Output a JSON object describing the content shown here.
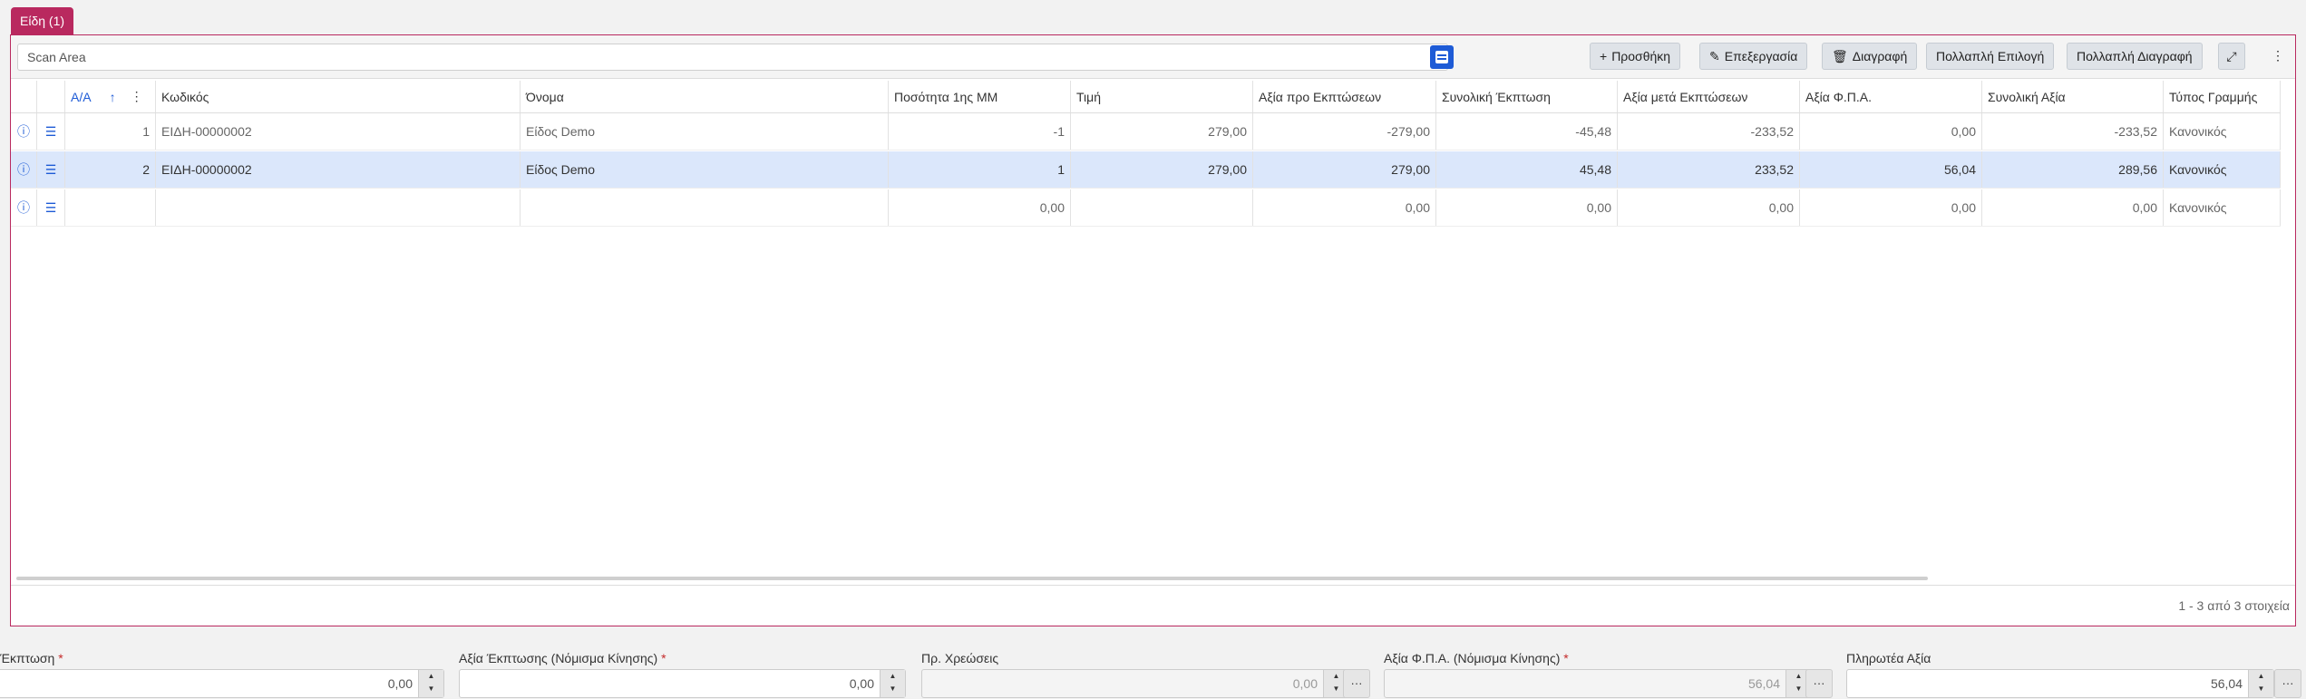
{
  "tab": {
    "label": "Είδη (1)"
  },
  "toolbar": {
    "scan_placeholder": "Scan Area",
    "add_label": "Προσθήκη",
    "edit_label": "Επεξεργασία",
    "delete_label": "Διαγραφή",
    "multi_select_label": "Πολλαπλή Επιλογή",
    "multi_delete_label": "Πολλαπλή Διαγραφή"
  },
  "columns": {
    "aa": "Α/Α",
    "code": "Κωδικός",
    "name": "Όνομα",
    "qty": "Ποσότητα 1ης ΜΜ",
    "price": "Τιμή",
    "value_before": "Αξία προ Εκπτώσεων",
    "total_discount": "Συνολική Έκπτωση",
    "value_after": "Αξία μετά Εκπτώσεων",
    "vat": "Αξία Φ.Π.Α.",
    "total": "Συνολική Αξία",
    "line_type": "Τύπος Γραμμής"
  },
  "rows": [
    {
      "aa": "1",
      "code": "ΕΙΔΗ-00000002",
      "name": "Είδος Demo",
      "qty": "-1",
      "price": "279,00",
      "value_before": "-279,00",
      "total_discount": "-45,48",
      "value_after": "-233,52",
      "vat": "0,00",
      "total": "-233,52",
      "line_type": "Κανονικός"
    },
    {
      "aa": "2",
      "code": "ΕΙΔΗ-00000002",
      "name": "Είδος Demo",
      "qty": "1",
      "price": "279,00",
      "value_before": "279,00",
      "total_discount": "45,48",
      "value_after": "233,52",
      "vat": "56,04",
      "total": "289,56",
      "line_type": "Κανονικός"
    },
    {
      "aa": "",
      "code": "",
      "name": "",
      "qty": "0,00",
      "price": "",
      "value_before": "0,00",
      "total_discount": "0,00",
      "value_after": "0,00",
      "vat": "0,00",
      "total": "0,00",
      "line_type": "Κανονικός"
    }
  ],
  "pager": "1 - 3 από 3 στοιχεία",
  "fields": {
    "discount": {
      "label": "Έκπτωση",
      "value": "0,00"
    },
    "discount_value_currency": {
      "label": "Αξία Έκπτωσης (Νόμισμα Κίνησης)",
      "value": "0,00"
    },
    "extra_charges": {
      "label": "Πρ. Χρεώσεις",
      "value": "0,00"
    },
    "vat_value_currency": {
      "label": "Αξία Φ.Π.Α. (Νόμισμα Κίνησης)",
      "value": "56,04"
    },
    "payable": {
      "label": "Πληρωτέα Αξία",
      "value": "56,04"
    }
  },
  "required_mark": "*",
  "colors": {
    "accent": "#b9295f",
    "primary": "#1e5bd6",
    "selected_row": "#dbe7fb"
  }
}
